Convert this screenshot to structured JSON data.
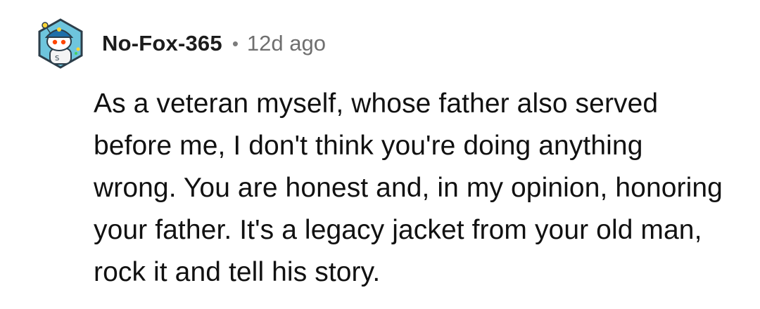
{
  "comment": {
    "author": "No-Fox-365",
    "separator": "•",
    "time_ago": "12d ago",
    "body": "As a veteran myself, whose father also served before me, I don't think you're doing anything wrong. You are honest and, in my opinion, honoring your father. It's a legacy jacket from your old man, rock it and tell his story."
  },
  "icons": {
    "avatar": "reddit-snoo-avatar-icon"
  },
  "colors": {
    "avatar_background": "#6ec5dd",
    "avatar_border": "#2c3e4a",
    "helmet": "#1f6fa9",
    "text": "#111111",
    "muted": "#6f6f6f"
  }
}
